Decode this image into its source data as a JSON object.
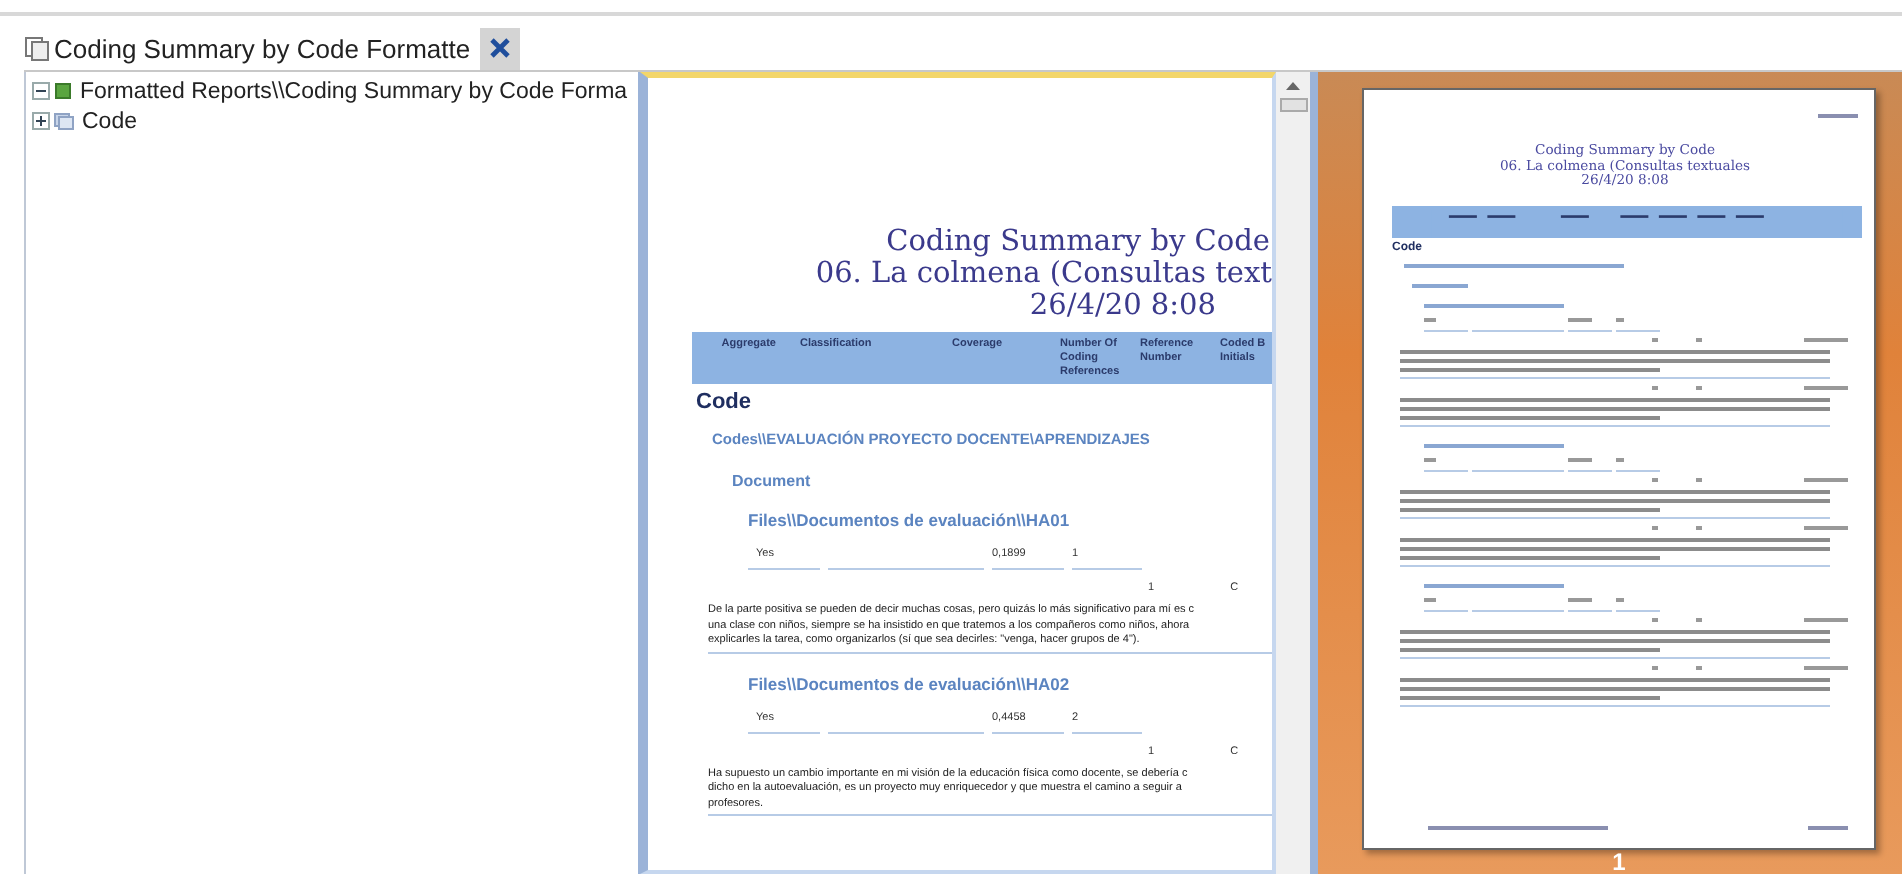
{
  "tab": {
    "title": "Coding Summary by Code Formatte",
    "selected": true
  },
  "tree": [
    {
      "label": "Formatted Reports\\\\Coding Summary by Code Forma",
      "expanded": true,
      "children": [
        {
          "label": "Code",
          "expanded": false
        }
      ]
    }
  ],
  "preview": {
    "title_lines": [
      "Coding Summary by Code",
      "06. La colmena (Consultas text",
      "26/4/20 8:08"
    ],
    "columns": [
      "Aggregate",
      "Classification",
      "Coverage",
      "Number Of Coding References",
      "Reference Number",
      "Coded B Initials"
    ],
    "section": "Code",
    "code_path": "Codes\\\\EVALUACIÓN PROYECTO DOCENTE\\APRENDIZAJES",
    "group": "Document",
    "files": [
      {
        "path": "Files\\\\Documentos de evaluación\\\\HA01",
        "cells": [
          "Yes",
          "0,1899",
          "1"
        ],
        "ref": [
          "1",
          "C"
        ],
        "lines": [
          "De la parte positiva se pueden de decir muchas cosas, pero quizás lo más significativo para mí es c",
          "una clase con niños, siempre se ha insistido en que tratemos a los compañeros como niños, ahora",
          "explicarles la tarea, como organizarlos (sí que sea decirles: \"venga, hacer grupos de 4\")."
        ]
      },
      {
        "path": "Files\\\\Documentos de evaluación\\\\HA02",
        "cells": [
          "Yes",
          "0,4458",
          "2"
        ],
        "ref": [
          "1",
          "C"
        ],
        "lines": [
          "Ha supuesto un cambio importante en mi visión de la educación física como docente, se debería c",
          "dicho en la autoevaluación, es un proyecto muy enriquecedor y que muestra el camino a seguir a",
          "profesores."
        ]
      }
    ]
  },
  "thumbnail": {
    "title_lines": [
      "Coding Summary by Code",
      "06. La colmena (Consultas textuales",
      "26/4/20 8:08"
    ],
    "section": "Code",
    "page_number": "1"
  }
}
